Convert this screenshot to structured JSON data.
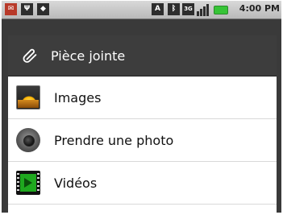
{
  "status_bar": {
    "time": "4:00 PM",
    "left_icons": [
      "mail-icon",
      "usb-icon",
      "android-icon"
    ],
    "right_icons": [
      "a-icon",
      "bluetooth-icon",
      "3g-icon",
      "signal-icon",
      "battery-icon"
    ],
    "a_glyph": "A",
    "net_glyph": "3G"
  },
  "dialog": {
    "title": "Pièce jointe",
    "items": [
      {
        "label": "Images"
      },
      {
        "label": "Prendre une photo"
      },
      {
        "label": "Vidéos"
      }
    ]
  },
  "colors": {
    "title_bg": "#3d3d3d",
    "video_green": "#1fa81f",
    "battery_green": "#37c437"
  }
}
